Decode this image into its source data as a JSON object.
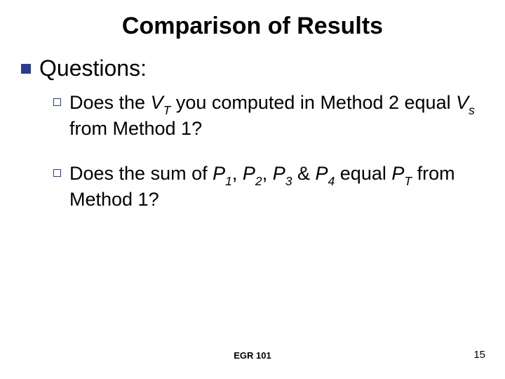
{
  "title": "Comparison of Results",
  "level1": "Questions:",
  "q1": {
    "pre": "Does the ",
    "var1": "V",
    "sub1": "T",
    "mid": " you computed in Method 2 equal ",
    "var2": "V",
    "sub2": "s",
    "post": " from Method 1?"
  },
  "q2": {
    "pre": "Does the sum of ",
    "p1v": "P",
    "p1s": "1",
    "c1": ", ",
    "p2v": "P",
    "p2s": "2",
    "c2": ", ",
    "p3v": "P",
    "p3s": "3",
    "amp": " & ",
    "p4v": "P",
    "p4s": "4",
    "eq": " equal ",
    "ptv": "P",
    "pts": "T",
    "post": " from Method 1?"
  },
  "footer_center": "EGR 101",
  "footer_right": "15"
}
